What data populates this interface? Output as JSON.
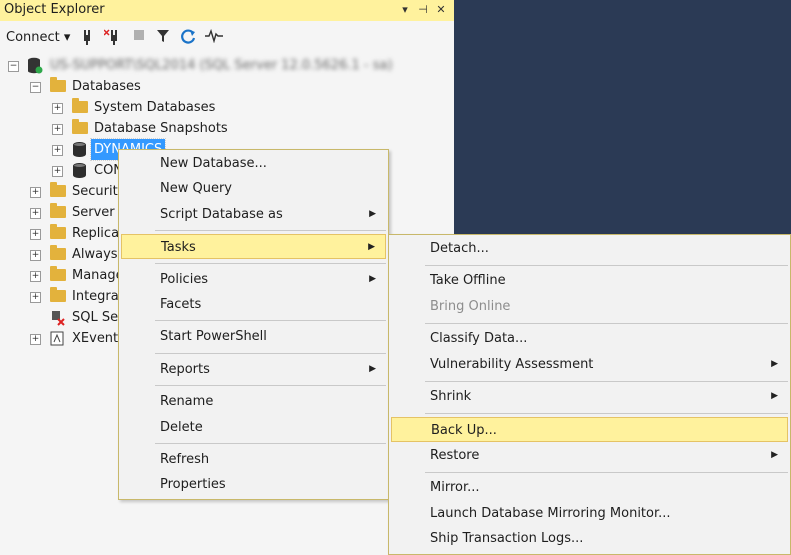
{
  "window": {
    "title": "Object Explorer",
    "title_buttons": [
      "▾",
      "⊣",
      "✕"
    ]
  },
  "toolbar": {
    "connect_label": "Connect ▾",
    "tools": [
      "plug-icon",
      "disconnect-icon",
      "stop-icon",
      "filter-icon",
      "refresh-icon",
      "activity-icon"
    ]
  },
  "tree": {
    "server": "US-SUPPORT\\SQL2014 (SQL Server 12.0.5626.1 - sa)",
    "databases": "Databases",
    "system_databases": "System Databases",
    "database_snapshots": "Database Snapshots",
    "dynamics": "DYNAMICS",
    "com": "CON",
    "security": "Security",
    "server_objects": "Server O",
    "replication": "Replicat",
    "always_on": "Always",
    "management": "Manage",
    "integration": "Integrat",
    "sql_agent": "SQL Ser",
    "xevent": "XEvent"
  },
  "context_menu": {
    "new_database": "New Database...",
    "new_query": "New Query",
    "script_database_as": "Script Database as",
    "tasks": "Tasks",
    "policies": "Policies",
    "facets": "Facets",
    "start_powershell": "Start PowerShell",
    "reports": "Reports",
    "rename": "Rename",
    "delete": "Delete",
    "refresh": "Refresh",
    "properties": "Properties"
  },
  "tasks_menu": {
    "detach": "Detach...",
    "take_offline": "Take Offline",
    "bring_online": "Bring Online",
    "classify_data": "Classify Data...",
    "vulnerability_assessment": "Vulnerability Assessment",
    "shrink": "Shrink",
    "back_up": "Back Up...",
    "restore": "Restore",
    "mirror": "Mirror...",
    "launch_mirroring_monitor": "Launch Database Mirroring Monitor...",
    "ship_transaction_logs": "Ship Transaction Logs..."
  },
  "colors": {
    "highlight": "#fff29d",
    "selection": "#3399ff",
    "background": "#2b3a55"
  }
}
